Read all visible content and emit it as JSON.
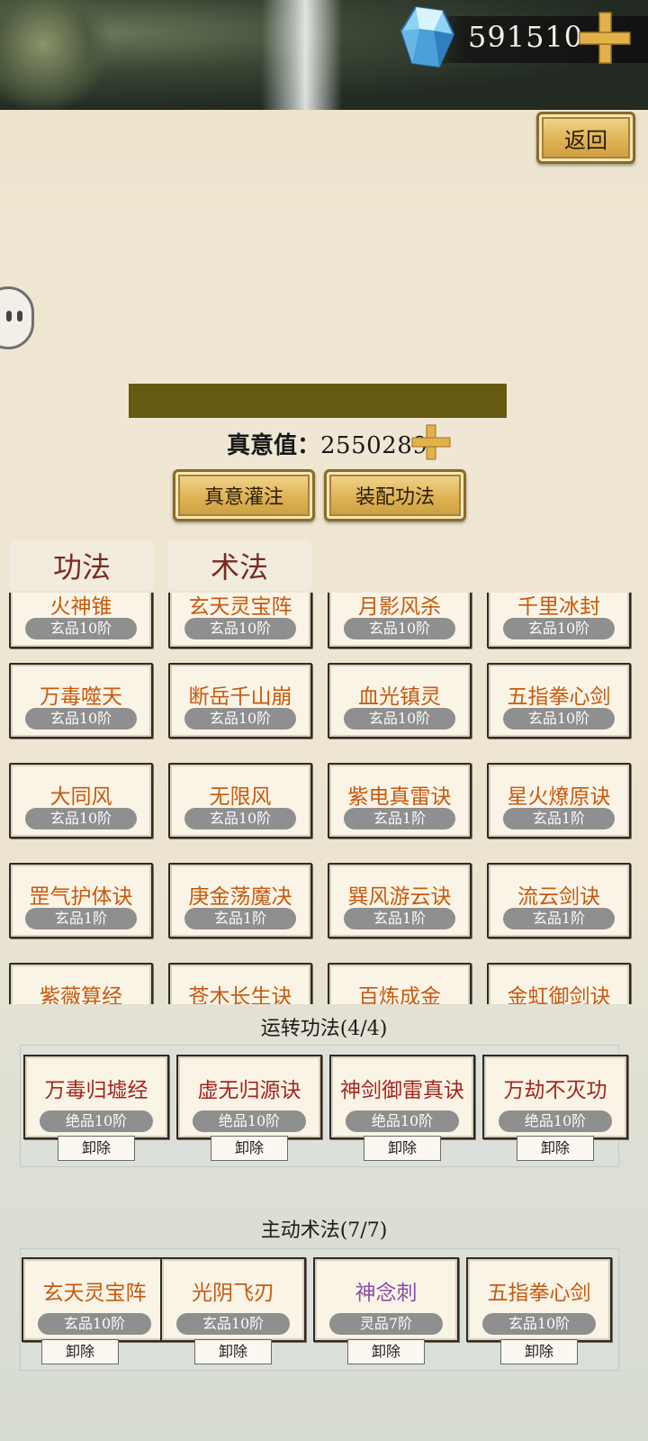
{
  "currency": {
    "amount": "591510"
  },
  "back_label": "返回",
  "essence": {
    "label": "真意值：",
    "value": "2550289"
  },
  "actions": {
    "infuse": "真意灌注",
    "equip": "装配功法"
  },
  "tabs": [
    "功法",
    "术法"
  ],
  "skill_grid": [
    [
      {
        "name": "火神锥",
        "grade": "玄品10阶"
      },
      {
        "name": "玄天灵宝阵",
        "grade": "玄品10阶"
      },
      {
        "name": "月影风杀",
        "grade": "玄品10阶"
      },
      {
        "name": "千里冰封",
        "grade": "玄品10阶"
      }
    ],
    [
      {
        "name": "万毒噬天",
        "grade": "玄品10阶"
      },
      {
        "name": "断岳千山崩",
        "grade": "玄品10阶"
      },
      {
        "name": "血光镇灵",
        "grade": "玄品10阶"
      },
      {
        "name": "五指拳心剑",
        "grade": "玄品10阶"
      }
    ],
    [
      {
        "name": "大同风",
        "grade": "玄品10阶"
      },
      {
        "name": "无限风",
        "grade": "玄品10阶"
      },
      {
        "name": "紫电真雷诀",
        "grade": "玄品1阶"
      },
      {
        "name": "星火燎原诀",
        "grade": "玄品1阶"
      }
    ],
    [
      {
        "name": "罡气护体诀",
        "grade": "玄品1阶"
      },
      {
        "name": "庚金荡魔决",
        "grade": "玄品1阶"
      },
      {
        "name": "巽风游云诀",
        "grade": "玄品1阶"
      },
      {
        "name": "流云剑诀",
        "grade": "玄品1阶"
      }
    ],
    [
      {
        "name": "紫薇算经",
        "grade": ""
      },
      {
        "name": "苍木长生诀",
        "grade": ""
      },
      {
        "name": "百炼成金",
        "grade": ""
      },
      {
        "name": "金虹御剑诀",
        "grade": ""
      }
    ]
  ],
  "running": {
    "title": "运转功法(4/4)",
    "items": [
      {
        "name": "万毒归墟经",
        "grade": "绝品10阶",
        "unload": "卸除"
      },
      {
        "name": "虚无归源诀",
        "grade": "绝品10阶",
        "unload": "卸除"
      },
      {
        "name": "神剑御雷真诀",
        "grade": "绝品10阶",
        "unload": "卸除"
      },
      {
        "name": "万劫不灭功",
        "grade": "绝品10阶",
        "unload": "卸除"
      }
    ]
  },
  "active": {
    "title": "主动术法(7/7)",
    "items": [
      {
        "name": "玄天灵宝阵",
        "grade": "玄品10阶",
        "unload": "卸除"
      },
      {
        "name": "光阴飞刃",
        "grade": "玄品10阶",
        "unload": "卸除"
      },
      {
        "name": "神念刺",
        "grade": "灵品7阶",
        "unload": "卸除"
      },
      {
        "name": "五指拳心剑",
        "grade": "玄品10阶",
        "unload": "卸除"
      }
    ]
  },
  "colors": {
    "gold": "#e0b659",
    "banner": "#665a12",
    "name_orange": "#c75a10",
    "name_red": "#a3261f",
    "name_purple": "#8a4fa8"
  }
}
